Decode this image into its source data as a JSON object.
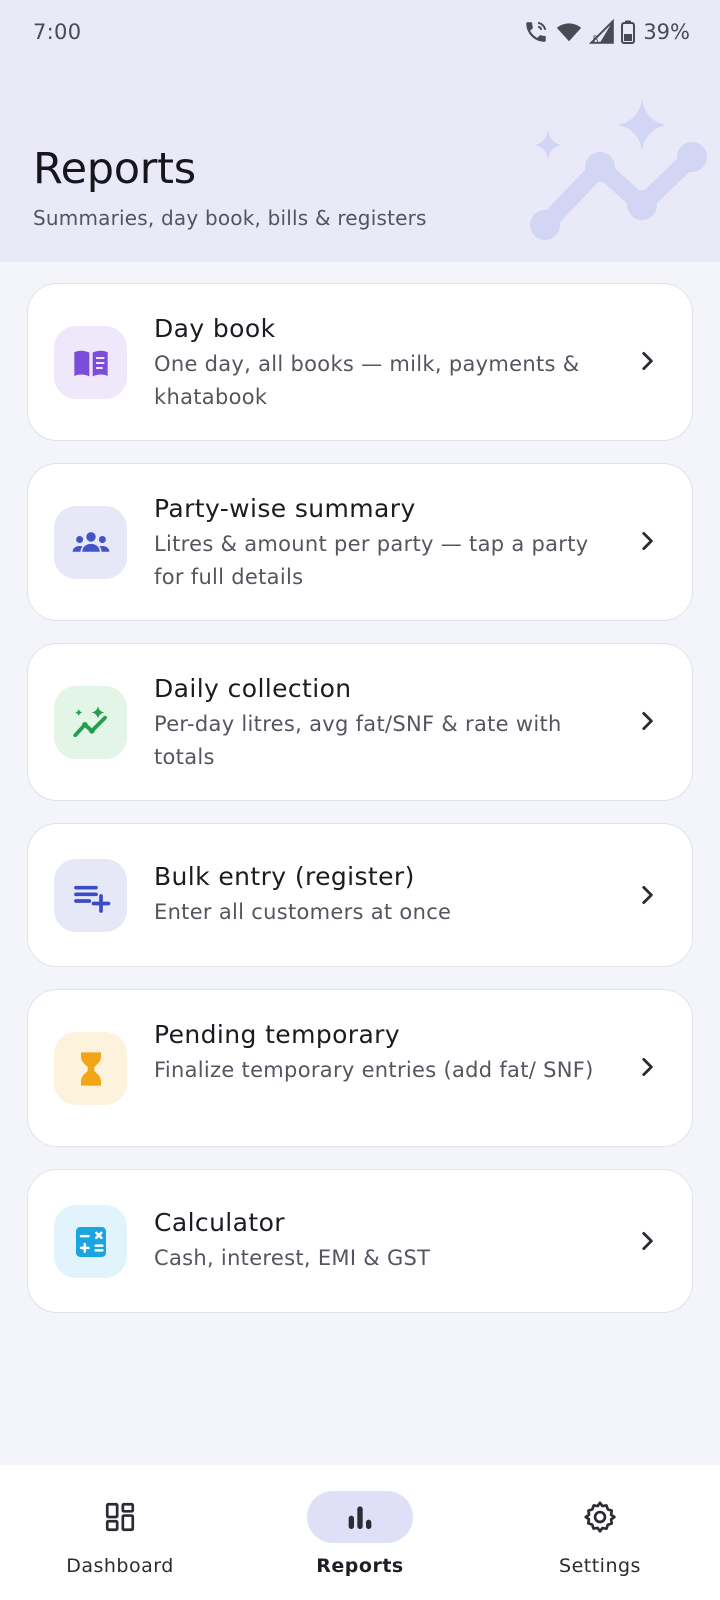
{
  "status_bar": {
    "time": "7:00",
    "battery_percent": "39%"
  },
  "header": {
    "title": "Reports",
    "subtitle": "Summaries, day book, bills & registers"
  },
  "reports": [
    {
      "title": "Day book",
      "description": "One day, all books — milk, payments & khatabook",
      "icon": "book-open-icon",
      "icon_color": "#7c4ddb",
      "icon_bg": "#efe8fb"
    },
    {
      "title": "Party-wise summary",
      "description": "Litres & amount per party — tap a party for full details",
      "icon": "group-icon",
      "icon_color": "#4454c7",
      "icon_bg": "#e6e8f8"
    },
    {
      "title": "Daily collection",
      "description": "Per-day litres, avg fat/SNF & rate with totals",
      "icon": "trend-sparkle-icon",
      "icon_color": "#22a04b",
      "icon_bg": "#e3f5e7"
    },
    {
      "title": "Bulk entry (register)",
      "description": "Enter all customers at once",
      "icon": "playlist-add-icon",
      "icon_color": "#3b4bc2",
      "icon_bg": "#e6e8f8"
    },
    {
      "title": "Pending temporary",
      "description": "Finalize temporary entries (add fat/ SNF)",
      "icon": "hourglass-icon",
      "icon_color": "#f2a516",
      "icon_bg": "#fdf2dc"
    },
    {
      "title": "Calculator",
      "description": "Cash, interest, EMI & GST",
      "icon": "calculator-icon",
      "icon_color": "#1aa5e0",
      "icon_bg": "#e1f3fb"
    }
  ],
  "bottom_nav": {
    "items": [
      {
        "label": "Dashboard",
        "icon": "dashboard-icon"
      },
      {
        "label": "Reports",
        "icon": "bar-chart-icon",
        "active": true
      },
      {
        "label": "Settings",
        "icon": "gear-icon"
      }
    ]
  },
  "colors": {
    "header_bg": "#e9e9f8",
    "page_bg": "#f4f5fa",
    "active_nav_pill": "#dfe0f7",
    "decor": "#cfd2f3"
  }
}
